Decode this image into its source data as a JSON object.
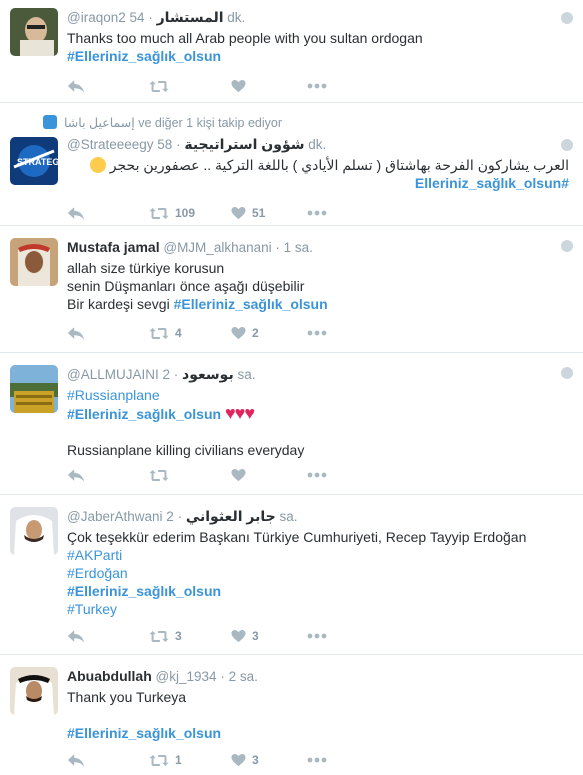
{
  "tweets": [
    {
      "name": "المستشار",
      "handle": "@iraqon2",
      "time": "54 dk.",
      "lines": [
        "Thanks too much all Arab people with you sultan ordogan"
      ],
      "hashtag": "#Elleriniz_sağlık_olsun",
      "retweets": "",
      "likes": ""
    },
    {
      "follow_note": "إسماعيل باشا ve diğer 1 kişi takip ediyor",
      "name": "شؤون استراتيجية",
      "handle": "@Strateeeegy",
      "time": "58 dk.",
      "lines": [
        "العرب يشاركون الفرحة بهاشتاق ( تسلم الأيادي ) باللغة التركية .. عصفورين بحجر"
      ],
      "hashtag": "#Elleriniz_sağlık_olsun",
      "retweets": "109",
      "likes": "51"
    },
    {
      "name": "Mustafa jamal",
      "handle": "@MJM_alkhanani",
      "time": "1 sa.",
      "lines": [
        "allah size türkiye korusun",
        "senin Düşmanları önce aşağı düşebilir",
        "Bir kardeşi sevgi"
      ],
      "hashtag": "#Elleriniz_sağlık_olsun",
      "retweets": "4",
      "likes": "2"
    },
    {
      "name": "بوسعود",
      "handle": "@ALLMUJAINI",
      "time": "2 sa.",
      "lines": [
        "Russianplane killing civilians  everyday"
      ],
      "hashtags": [
        "#Russianplane",
        "#Elleriniz_sağlık_olsun"
      ],
      "hearts": "♥♥♥",
      "retweets": "",
      "likes": ""
    },
    {
      "name": "جابر العثواني",
      "handle": "@JaberAthwani",
      "time": "2 sa.",
      "lines": [
        "Çok teşekkür ederim Başkanı Türkiye Cumhuriyeti, Recep Tayyip Erdoğan"
      ],
      "hashtags": [
        "#AKParti",
        "#Erdoğan",
        "#Elleriniz_sağlık_olsun",
        "#Turkey"
      ],
      "retweets": "3",
      "likes": "3"
    },
    {
      "name": "Abuabdullah",
      "handle": "@kj_1934",
      "time": "2 sa.",
      "lines": [
        "Thank you Turkeya"
      ],
      "hashtag": "#Elleriniz_sağlık_olsun",
      "retweets": "1",
      "likes": "3"
    }
  ],
  "icons": {
    "reply": "reply-icon",
    "retweet": "retweet-icon",
    "like": "heart-icon",
    "more": "more-icon",
    "globe": "globe-icon"
  },
  "colors": {
    "link": "#3b94d9",
    "muted": "#8899a6",
    "text": "#292f33",
    "heart": "#e0245e"
  }
}
